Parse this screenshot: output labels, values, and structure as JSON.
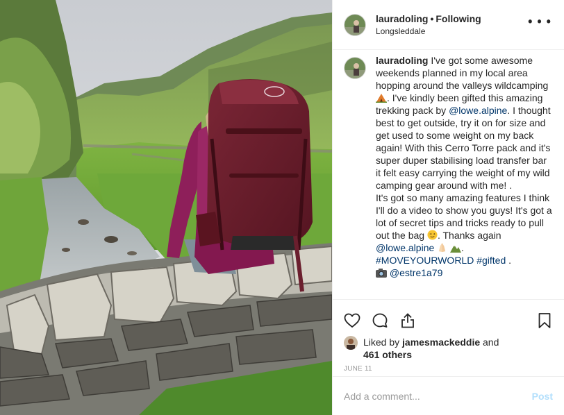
{
  "header": {
    "username": "lauradoling",
    "separator": "•",
    "follow_status": "Following",
    "location": "Longsleddale",
    "more_icon": "ellipsis-icon"
  },
  "caption": {
    "username": "lauradoling",
    "seg1": " I've got some awesome weekends planned in my local area hopping around the valleys wildcamping ",
    "emoji_tent": "tent-emoji",
    "seg2": ". I've kindly been gifted this amazing trekking pack by ",
    "mention1": "@lowe.alpine",
    "seg3": ". I thought best to get outside, try it on for size and get used to some weight on my back again! With this Cerro Torre pack and it's super duper stabilising load transfer bar it felt easy carrying the weight of my wild camping gear around with me! .",
    "seg4": "It's got so many amazing features I think I'll do a video to show you guys! It's got a lot of secret tips and tricks ready to pull out the bag ",
    "emoji_wink": "winking-face-emoji",
    "seg5": ". Thanks again ",
    "mention2": "@lowe.alpine",
    "emoji_pray": "folded-hands-emoji",
    "emoji_mountain": "mountain-emoji",
    "seg6": ".",
    "hashtag1": "#MOVEYOURWORLD",
    "hashtag2": "#gifted",
    "seg7": " .",
    "emoji_camera": "camera-emoji",
    "credit": "@estre1a79"
  },
  "actions": {
    "like_icon": "heart-icon",
    "comment_icon": "comment-icon",
    "share_icon": "share-icon",
    "save_icon": "bookmark-icon"
  },
  "likes": {
    "prefix": "Liked by ",
    "user": "jamesmackeddie",
    "middle": " and",
    "others": "461 others"
  },
  "date": "JUNE 11",
  "comment": {
    "placeholder": "Add a comment...",
    "post_label": "Post"
  },
  "colors": {
    "link": "#003569",
    "post_disabled": "#b2dffc",
    "border": "#efefef",
    "pack": "#6b1f2e",
    "jacket": "#8e1f5a"
  }
}
